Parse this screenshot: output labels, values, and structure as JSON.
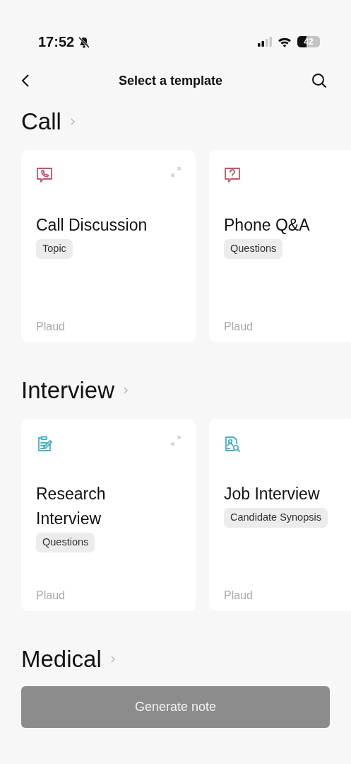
{
  "status_bar": {
    "time": "17:52",
    "battery": "42"
  },
  "header": {
    "title": "Select a template"
  },
  "sections": [
    {
      "title": "Call",
      "color": "#c9536a",
      "cards": [
        {
          "title": "Call Discussion",
          "tag": "Topic",
          "author": "Plaud",
          "kind": "phone-chat",
          "expand_icon": true
        },
        {
          "title": "Phone Q&A",
          "tag": "Questions",
          "author": "Plaud",
          "kind": "question-chat",
          "expand_icon": false
        }
      ]
    },
    {
      "title": "Interview",
      "color": "#45b0c4",
      "cards": [
        {
          "title": "Research Interview",
          "tag": "Questions",
          "author": "Plaud",
          "kind": "note-edit",
          "expand_icon": true
        },
        {
          "title": "Job Interview",
          "tag": "Candidate Synopsis",
          "author": "Plaud",
          "kind": "person-search",
          "expand_icon": false
        }
      ]
    },
    {
      "title": "Medical"
    }
  ],
  "button": {
    "label": "Generate note",
    "disabled": true
  }
}
